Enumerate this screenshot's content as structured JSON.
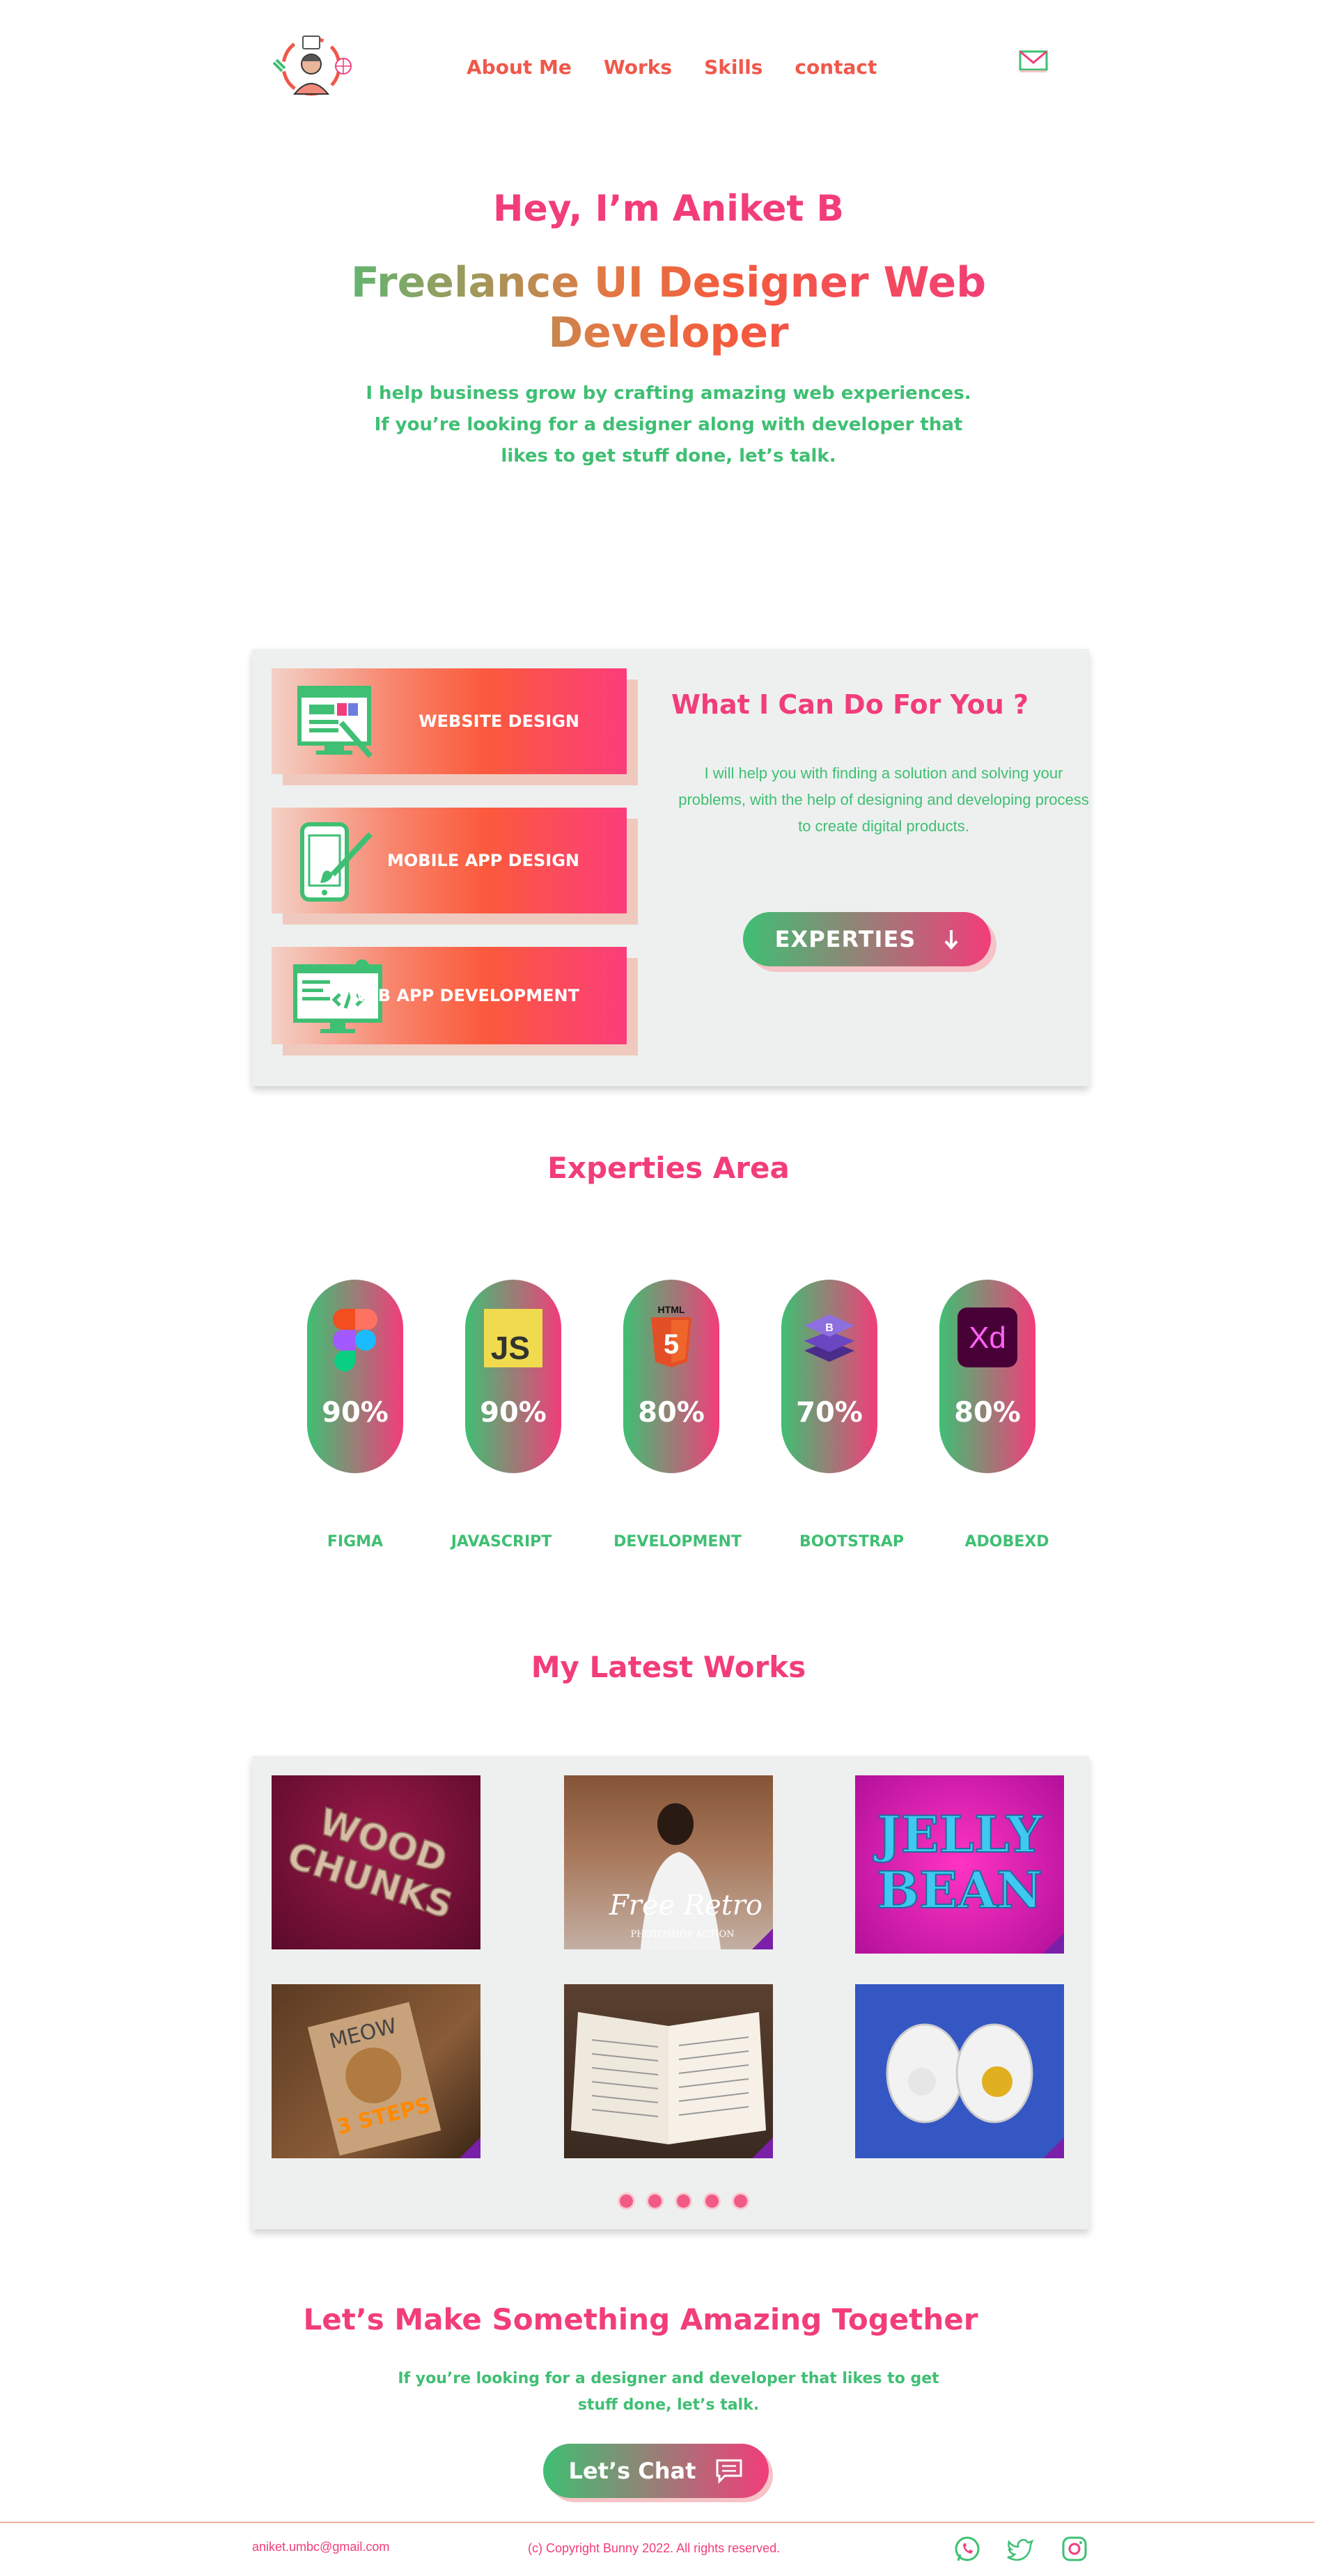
{
  "nav": {
    "items": [
      "About Me",
      "Works",
      "Skills",
      "contact"
    ]
  },
  "icons": {
    "logo": "avatar-logo-icon",
    "mail": "mail-icon",
    "arrow": "arrow-down-icon",
    "chat": "chat-bubble-icon",
    "social": [
      "whatsapp-icon",
      "twitter-icon",
      "instagram-icon"
    ]
  },
  "hero": {
    "greeting": "Hey, I’m Aniket B",
    "title": "Freelance UI Designer  Web Developer",
    "description": "I help business grow by crafting amazing web experiences. If you’re looking for a designer along with developer that likes to get stuff done, let’s talk."
  },
  "services": {
    "items": [
      {
        "label": "WEBSITE DESIGN",
        "icon": "website-design-icon"
      },
      {
        "label": "MOBILE APP DESIGN",
        "icon": "mobile-app-icon"
      },
      {
        "label": "WEB APP DEVELOPMENT",
        "icon": "web-app-icon"
      }
    ],
    "title": "What I Can Do For  You ?",
    "description": "I will help you with finding a solution and solving your problems, with the help of  designing and developing process to create digital products.",
    "button": "EXPERTIES"
  },
  "expertise": {
    "title": "Experties Area",
    "skills": [
      {
        "name": "FIGMA",
        "percent": "90%",
        "icon": "figma-icon"
      },
      {
        "name": "JAVASCRIPT",
        "percent": "90%",
        "icon": "javascript-icon"
      },
      {
        "name": "DEVELOPMENT",
        "percent": "80%",
        "icon": "html5-icon"
      },
      {
        "name": "BOOTSTRAP",
        "percent": "70%",
        "icon": "bootstrap-icon"
      },
      {
        "name": "ADOBEXD",
        "percent": "80%",
        "icon": "adobe-xd-icon"
      }
    ],
    "js_logo_text": "JS",
    "html_logo_text": "HTML",
    "html_logo_number": "5",
    "xd_logo_text": "Xd"
  },
  "works": {
    "title": "My Latest Works",
    "items": [
      {
        "text_line1": "WOOD",
        "text_line2": "CHUNKS"
      },
      {
        "text_line1": "Free Retro",
        "text_line2": "PHOTOSHOP ACTION"
      },
      {
        "text_line1": "JELLY",
        "text_line2": "BEAN"
      },
      {
        "text_line1": "MEOW",
        "text_line2": "3 STEPS"
      },
      {
        "text_line1": "",
        "text_line2": ""
      },
      {
        "text_line1": "",
        "text_line2": ""
      }
    ],
    "dot_count": 5,
    "colors": {
      "dot": "#f25a86"
    }
  },
  "cta": {
    "title": "Let’s Make Something Amazing Together",
    "description": "If you’re looking for a designer and developer that likes to get stuff done, let’s talk.",
    "button": "Let’s Chat"
  },
  "footer": {
    "email": "aniket.umbc@gmail.com",
    "copyright": "(c) Copyright Bunny 2022. All rights reserved."
  },
  "colors": {
    "primary_pink": "#f23d7a",
    "primary_green": "#3fbf73",
    "orange": "#f0584a",
    "panel": "#eef0ef"
  }
}
